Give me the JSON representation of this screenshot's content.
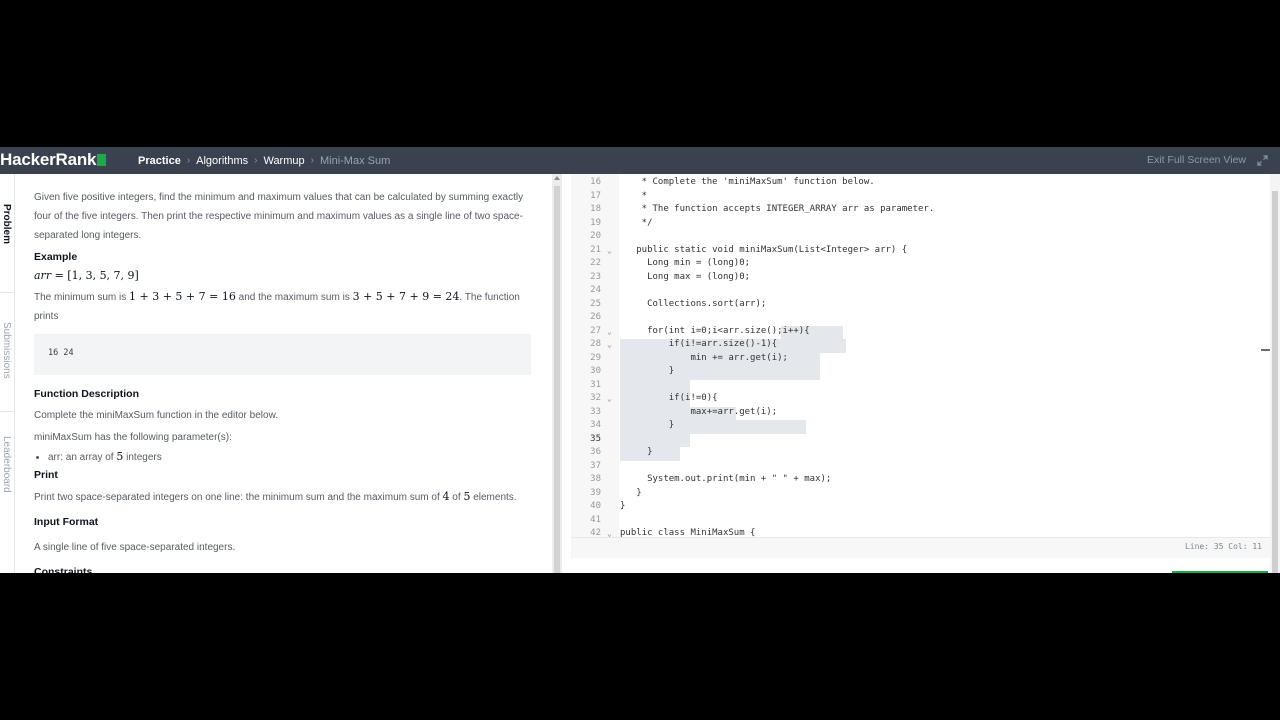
{
  "header": {
    "logo": "HackerRank",
    "breadcrumb": [
      "Practice",
      "Algorithms",
      "Warmup",
      "Mini-Max Sum"
    ],
    "exit_fullscreen": "Exit Full Screen View",
    "brand_color": "#1ba94c",
    "bar_color": "#39424e"
  },
  "rail": {
    "tabs": [
      "Problem",
      "Submissions",
      "Leaderboard"
    ]
  },
  "problem": {
    "intro": "Given five positive integers, find the minimum and maximum values that can be calculated by summing exactly four of the five integers. Then print the respective minimum and maximum values as a single line of two space-separated long integers.",
    "example_heading": "Example",
    "example_var": "arr",
    "example_value": " = [1, 3, 5, 7, 9]",
    "sum_text_1": "The minimum sum is ",
    "min_expr": "1 + 3 + 5 + 7 = 16",
    "sum_text_2": " and the maximum sum is ",
    "max_expr": "3 + 5 + 7 + 9 = 24",
    "sum_text_3": ". The function prints",
    "output": "16 24",
    "func_desc_heading": "Function Description",
    "func_desc": "Complete the miniMaxSum function in the editor below.",
    "params_intro": "miniMaxSum has the following parameter(s):",
    "param_1a": "arr: an array of ",
    "param_1n": "5",
    "param_1b": " integers",
    "print_heading": "Print",
    "print_a": "Print two space-separated integers on one line: the minimum sum and the maximum sum of ",
    "print_n1": "4",
    "print_of": " of ",
    "print_n2": "5",
    "print_b": " elements.",
    "input_heading": "Input Format",
    "input_text": "A single line of five space-separated integers.",
    "constraints_heading": "Constraints"
  },
  "editor": {
    "lines": [
      {
        "n": "16",
        "t": "    * Complete the 'miniMaxSum' function below.",
        "cls": "cm"
      },
      {
        "n": "17",
        "t": "    *",
        "cls": "cm"
      },
      {
        "n": "18",
        "t": "    * The function accepts INTEGER_ARRAY arr as parameter.",
        "cls": "cm"
      },
      {
        "n": "19",
        "t": "    */",
        "cls": "cm"
      },
      {
        "n": "20",
        "t": ""
      },
      {
        "n": "21",
        "t": "   public static void miniMaxSum(List<Integer> arr) {",
        "fold": true
      },
      {
        "n": "22",
        "t": "     Long min = (long)0;"
      },
      {
        "n": "23",
        "t": "     Long max = (long)0;"
      },
      {
        "n": "24",
        "t": ""
      },
      {
        "n": "25",
        "t": "     Collections.sort(arr);"
      },
      {
        "n": "26",
        "t": ""
      },
      {
        "n": "27",
        "t": "     for(int i=0;i<arr.size();i++){",
        "fold": true
      },
      {
        "n": "28",
        "t": "         if(i!=arr.size()-1){",
        "fold": true
      },
      {
        "n": "29",
        "t": "             min += arr.get(i);"
      },
      {
        "n": "30",
        "t": "         }"
      },
      {
        "n": "31",
        "t": ""
      },
      {
        "n": "32",
        "t": "         if(i!=0){",
        "fold": true
      },
      {
        "n": "33",
        "t": "             max+=arr.get(i);"
      },
      {
        "n": "34",
        "t": "         }"
      },
      {
        "n": "35",
        "t": "",
        "active": true
      },
      {
        "n": "36",
        "t": "     }"
      },
      {
        "n": "37",
        "t": ""
      },
      {
        "n": "38",
        "t": "     System.out.print(min + \" \" + max);"
      },
      {
        "n": "39",
        "t": "   }"
      },
      {
        "n": "40",
        "t": "}"
      },
      {
        "n": "41",
        "t": ""
      },
      {
        "n": "42",
        "t": "public class MiniMaxSum {",
        "fold": true
      }
    ],
    "status": "Line: 35 Col: 11"
  }
}
